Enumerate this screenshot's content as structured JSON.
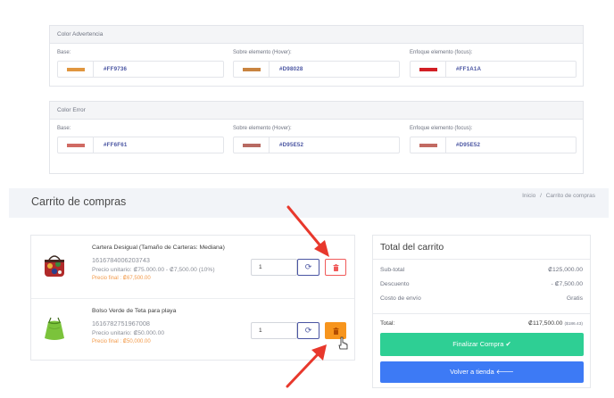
{
  "warning_panel": {
    "title": "Color Advertencia",
    "colors": [
      {
        "label": "Base:",
        "hex": "#FF9736",
        "swatch": "#e0963f"
      },
      {
        "label": "Sobre elemento (Hover):",
        "hex": "#D98028",
        "swatch": "#c98440"
      },
      {
        "label": "Enfoque elemento (focus):",
        "hex": "#FF1A1A",
        "swatch": "#d21f24"
      }
    ]
  },
  "error_panel": {
    "title": "Color Error",
    "colors": [
      {
        "label": "Base:",
        "hex": "#FF6F61",
        "swatch": "#d06a63"
      },
      {
        "label": "Sobre elemento (Hover):",
        "hex": "#D95E52",
        "swatch": "#b86a62"
      },
      {
        "label": "Enfoque elemento (focus):",
        "hex": "#D95E52",
        "swatch": "#c26a62"
      }
    ]
  },
  "page": {
    "title": "Carrito de compras",
    "breadcrumb": [
      "Inicio",
      "/",
      "Carrito de compras"
    ]
  },
  "cart": {
    "items": [
      {
        "name": "Cartera Desigual (Tamaño de Carteras: Mediana)",
        "sku": "1616784006203743",
        "unit_price": "Precio unitario: ₡75.000.00 - ₡7,500.00 (10%)",
        "final_price": "Precio final : ₡67,500.00",
        "quantity": "1",
        "image": "red-floral-handbag"
      },
      {
        "name": "Bolso Verde de Teta para playa",
        "sku": "1616782751967008",
        "unit_price": "Precio unitario: ₡50.000.00",
        "final_price": "Precio final : ₡50,000.00",
        "quantity": "1",
        "image": "green-drawstring-bag"
      }
    ]
  },
  "totals": {
    "title": "Total del carrito",
    "subtotal_label": "Sub-total",
    "subtotal_value": "₡125,000.00",
    "discount_label": "Descuento",
    "discount_value": "- ₡7,500.00",
    "shipping_label": "Costo de envío",
    "shipping_value": "Gratis",
    "total_label": "Total:",
    "total_value": "₡117,500.00",
    "total_usd": "($186.43)",
    "checkout_label": "Finalizar Compra ✔",
    "back_label": "Volver a tienda 🡐"
  },
  "colors": {
    "accent_blue": "#4a55a2",
    "green_button": "#2ecf94",
    "blue_button": "#3d7af5",
    "annotation_red": "#e8382c"
  }
}
